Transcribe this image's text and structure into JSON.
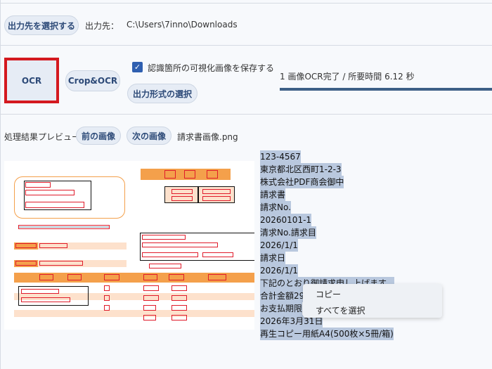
{
  "toolbar": {
    "select_output_label": "出力先を選択する",
    "output_prefix": "出力先：",
    "output_path": "C:\\Users\\7inno\\Downloads"
  },
  "actions": {
    "ocr_label": "OCR",
    "crop_ocr_label": "Crop&OCR",
    "save_visualization_label": "認識箇所の可視化画像を保存する",
    "save_visualization_checked": true,
    "output_format_label": "出力形式の選択",
    "status": "1 画像OCR完了 / 所要時間 6.12 秒",
    "progress": 1.0
  },
  "preview": {
    "label": "処理結果プレビュー",
    "prev_label": "前の画像",
    "next_label": "次の画像",
    "filename": "請求書画像.png"
  },
  "ocr_lines": [
    "123-4567",
    "東京都北区西町1-2-3",
    "株式会社PDF商会御中",
    "請求書",
    "請求No.",
    "20260101-1",
    "清求No.請求目",
    "2026/1/1",
    "請求日",
    "2026/1/1",
    "下記のとおり御請求申し上げます。",
    "合計金額29",
    "お支払期限",
    "2026年3月31日",
    "再生コピー用紙A4(500枚×5冊/箱)"
  ],
  "context_menu": {
    "copy_label": "コピー",
    "select_all_label": "すべてを選択"
  },
  "colors": {
    "accent_red": "#d4191f",
    "button_bg": "#e6ecf5",
    "progress": "#3d5f86",
    "selection": "#b9c8de"
  }
}
